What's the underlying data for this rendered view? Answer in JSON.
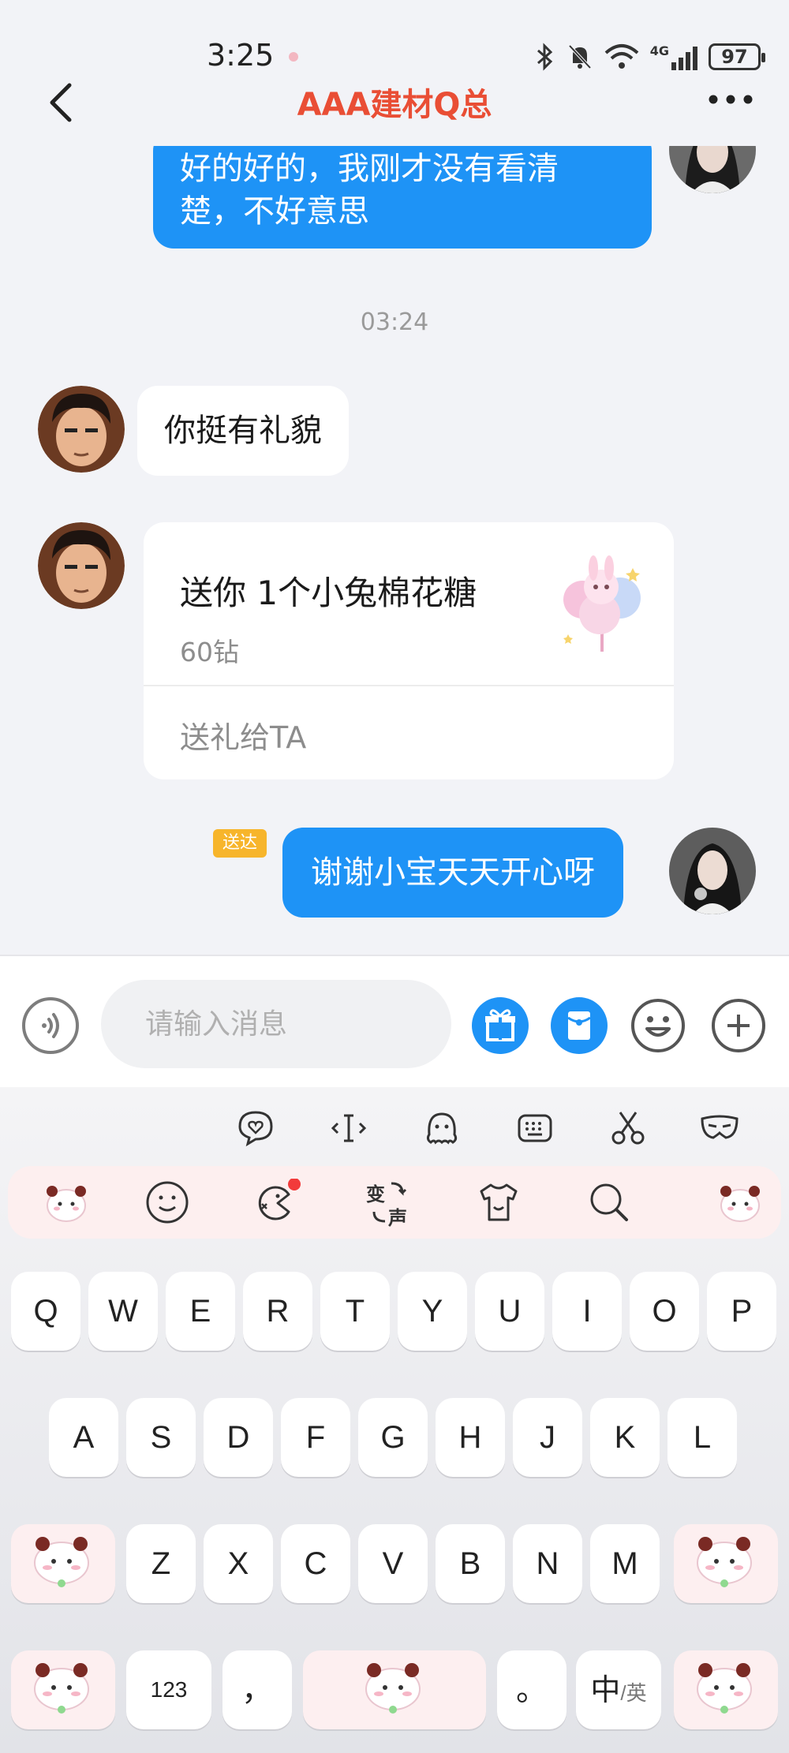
{
  "status_bar": {
    "time": "3:25",
    "battery": "97",
    "network": "4G"
  },
  "header": {
    "title": "AAA建材Q总",
    "back_icon": "chevron-left-icon",
    "more_icon": "more-dots-icon"
  },
  "messages": {
    "outgoing_1": {
      "text_line1": "好的好的，我刚才没有看清",
      "text_line2": "楚，不好意思"
    },
    "timestamp": "03:24",
    "incoming_1": {
      "text": "你挺有礼貌"
    },
    "gift": {
      "title": "送你 1个小兔棉花糖",
      "price": "60钻",
      "action": "送礼给TA"
    },
    "outgoing_2": {
      "text": "谢谢小宝天天开心呀",
      "badge": "送达"
    }
  },
  "input_bar": {
    "placeholder": "请输入消息",
    "buttons": [
      "voice-icon",
      "gift-icon",
      "red-packet-icon",
      "emoji-icon",
      "plus-icon"
    ]
  },
  "keyboard": {
    "tools": [
      "heart-chat-icon",
      "cursor-icon",
      "octopus-icon",
      "keyboard-icon",
      "scissors-icon",
      "mask-icon"
    ],
    "strip": [
      "panda-sticker",
      "smiley-icon",
      "pacman-icon",
      "voice-change-icon",
      "tshirt-icon",
      "search-icon",
      "panda-sticker"
    ],
    "voice_change_label_top": "变",
    "voice_change_label_bottom": "声",
    "row1": [
      "Q",
      "W",
      "E",
      "R",
      "T",
      "Y",
      "U",
      "I",
      "O",
      "P"
    ],
    "row2": [
      "A",
      "S",
      "D",
      "F",
      "G",
      "H",
      "J",
      "K",
      "L"
    ],
    "row3": [
      "Z",
      "X",
      "C",
      "V",
      "B",
      "N",
      "M"
    ],
    "row4": {
      "numbers": "123",
      "comma": "，",
      "period": "。",
      "lang_main": "中",
      "lang_alt": "/英"
    },
    "colors": {
      "strip_bg": "#fdefef",
      "key_bg": "#ffffff"
    }
  },
  "colors": {
    "title": "#e94e35",
    "bubble_out": "#1e93f6",
    "bubble_in": "#ffffff",
    "badge": "#f7b52b",
    "chat_bg": "#f2f3f7"
  }
}
